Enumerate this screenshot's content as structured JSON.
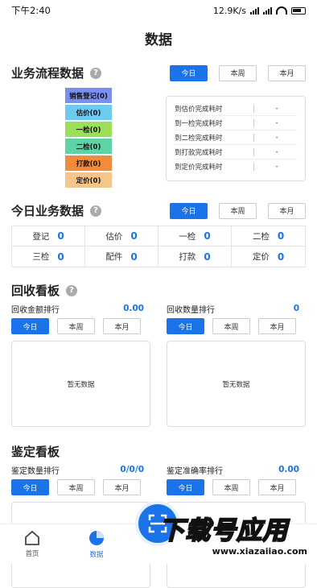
{
  "status_bar": {
    "time": "下午2:40",
    "speed": "12.9K/s",
    "battery": ""
  },
  "page": {
    "title": "数据"
  },
  "tabs": [
    "今日",
    "本周",
    "本月"
  ],
  "flow": {
    "title": "业务流程数据",
    "help": "?",
    "stages": [
      {
        "label": "销售登记(0)",
        "color": "#7b8ff2"
      },
      {
        "label": "估价(0)",
        "color": "#6ecbf0"
      },
      {
        "label": "一检(0)",
        "color": "#9be05a"
      },
      {
        "label": "二检(0)",
        "color": "#5ed3a6"
      },
      {
        "label": "打款(0)",
        "color": "#f28c3a"
      },
      {
        "label": "定价(0)",
        "color": "#f5c58c"
      }
    ],
    "timings": [
      {
        "label": "到估价完成耗时",
        "value": "-"
      },
      {
        "label": "到一检完成耗时",
        "value": "-"
      },
      {
        "label": "到二检完成耗时",
        "value": "-"
      },
      {
        "label": "到打款完成耗时",
        "value": "-"
      },
      {
        "label": "到定价完成耗时",
        "value": "-"
      }
    ]
  },
  "today": {
    "title": "今日业务数据",
    "help": "?",
    "cells": [
      {
        "label": "登记",
        "value": "0"
      },
      {
        "label": "估价",
        "value": "0"
      },
      {
        "label": "一检",
        "value": "0"
      },
      {
        "label": "二检",
        "value": "0"
      },
      {
        "label": "三检",
        "value": "0"
      },
      {
        "label": "配件",
        "value": "0"
      },
      {
        "label": "打款",
        "value": "0"
      },
      {
        "label": "定价",
        "value": "0"
      }
    ]
  },
  "recycle": {
    "title": "回收看板",
    "help": "?",
    "left": {
      "label": "回收金额排行",
      "value": "0.00",
      "empty": "暂无数据"
    },
    "right": {
      "label": "回收数量排行",
      "value": "0",
      "empty": "暂无数据"
    }
  },
  "appraisal": {
    "title": "鉴定看板",
    "left": {
      "label": "鉴定数量排行",
      "value": "0/0/0"
    },
    "right": {
      "label": "鉴定准确率排行",
      "value": "0.00"
    }
  },
  "nav": [
    {
      "label": "首页",
      "icon": "home-icon",
      "active": false
    },
    {
      "label": "数据",
      "icon": "pie-chart-icon",
      "active": true
    }
  ],
  "watermark": {
    "text": "下载号应用",
    "url": "www.xiazaiiao.com"
  },
  "colors": {
    "accent": "#1a73e8"
  }
}
